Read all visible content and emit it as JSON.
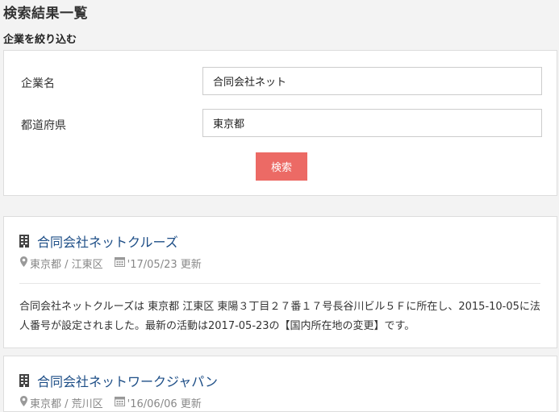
{
  "page": {
    "title": "検索結果一覧",
    "filter_heading": "企業を絞り込む"
  },
  "filter": {
    "company_label": "企業名",
    "company_value": "合同会社ネット",
    "prefecture_label": "都道府県",
    "prefecture_value": "東京都",
    "search_label": "検索",
    "accent_color": "#ec6a65"
  },
  "results": [
    {
      "name": "合同会社ネットクルーズ",
      "location": "東京都 / 江東区",
      "updated": "'17/05/23 更新",
      "description": "合同会社ネットクルーズは 東京都 江東区 東陽３丁目２７番１７号長谷川ビル５Ｆに所在し、2015-10-05に法人番号が設定されました。最新の活動は2017-05-23の【国内所在地の変更】です。"
    },
    {
      "name": "合同会社ネットワークジャパン",
      "location": "東京都 / 荒川区",
      "updated": "'16/06/06 更新"
    }
  ],
  "icons": {
    "building": "building-icon",
    "location": "map-marker-icon",
    "date": "calendar-icon"
  },
  "colors": {
    "link": "#1c4d86",
    "meta": "#888888",
    "background": "#f3f3f3"
  }
}
